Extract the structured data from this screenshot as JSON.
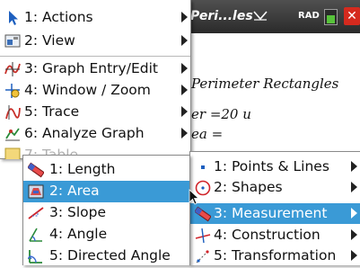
{
  "header": {
    "doc_title": "Peri...les",
    "angle_mode": "RAD"
  },
  "document": {
    "title_line": "Perimeter Rectangles",
    "line2": "er =20 u",
    "line3": "ea ="
  },
  "main_menu": {
    "items": [
      {
        "label": "1: Actions"
      },
      {
        "label": "2: View"
      },
      {
        "label": "3: Graph Entry/Edit"
      },
      {
        "label": "4: Window / Zoom"
      },
      {
        "label": "5: Trace"
      },
      {
        "label": "6: Analyze Graph"
      },
      {
        "label": "7: Table"
      }
    ]
  },
  "geometry_menu": {
    "items": [
      {
        "label": "1: Points & Lines"
      },
      {
        "label": "2: Shapes"
      },
      {
        "label": "3: Measurement"
      },
      {
        "label": "4: Construction"
      },
      {
        "label": "5: Transformation"
      }
    ]
  },
  "measurement_menu": {
    "items": [
      {
        "label": "1: Length"
      },
      {
        "label": "2: Area"
      },
      {
        "label": "3: Slope"
      },
      {
        "label": "4: Angle"
      },
      {
        "label": "5: Directed Angle"
      }
    ]
  },
  "colors": {
    "selection": "#3a9ad6",
    "close_button": "#d52a1e"
  }
}
